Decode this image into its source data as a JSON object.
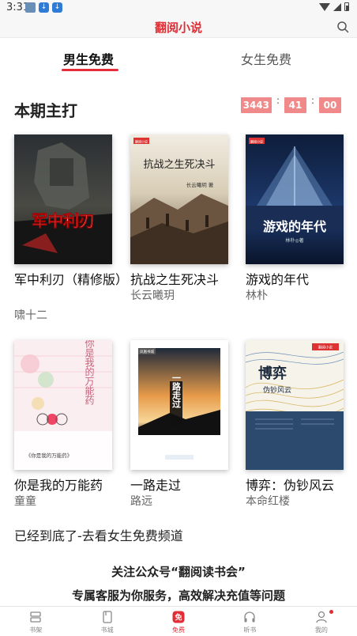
{
  "status_bar": {
    "time": "3:31"
  },
  "header": {
    "title": "翻阅小说"
  },
  "tabs": [
    {
      "label": "男生免费",
      "active": true
    },
    {
      "label": "女生免费",
      "active": false
    }
  ],
  "section": {
    "title": "本期主打",
    "countdown": {
      "hours": "3443",
      "minutes": "41",
      "seconds": "00",
      "separator": ":"
    }
  },
  "books": [
    {
      "title": "军中利刃（精修版）",
      "author": "啸十二",
      "cover_text": "军中利刃"
    },
    {
      "title": "抗战之生死决斗",
      "author": "长云曦玥",
      "cover_text": "抗战之生死决斗",
      "cover_sub": "长云曦玥 著",
      "publisher": "翻阅小说"
    },
    {
      "title": "游戏的年代",
      "author": "林朴",
      "cover_text": "游戏的年代",
      "cover_sub": "林朴◎著",
      "publisher": "翻阅小说"
    },
    {
      "title": "你是我的万能药",
      "author": "童童",
      "cover_text": "你是我的万能药",
      "cover_sub": "《你是我的万能药》"
    },
    {
      "title": "一路走过",
      "author": "路远",
      "cover_text": "一路走过",
      "publisher": "凤凰书城"
    },
    {
      "title": "博弈：伪钞风云",
      "author": "本命红楼",
      "cover_text": "博弈",
      "cover_sub": "伪钞风云",
      "publisher": "翻阅小说"
    }
  ],
  "end_note": "已经到底了-去看女生免费频道",
  "promo": {
    "line1": "关注公众号“翻阅读书会”",
    "line2": "专属客服为你服务，高效解决充值等问题"
  },
  "bottom_nav": [
    {
      "label": "书架",
      "icon": "bookshelf-icon",
      "active": false
    },
    {
      "label": "书城",
      "icon": "bookstore-icon",
      "active": false
    },
    {
      "label": "免费",
      "icon": "free-icon",
      "active": true
    },
    {
      "label": "听书",
      "icon": "headphones-icon",
      "active": false
    },
    {
      "label": "我的",
      "icon": "profile-icon",
      "active": false
    }
  ],
  "colors": {
    "accent": "#e02e36",
    "countdown_bg": "#f08a8a"
  }
}
